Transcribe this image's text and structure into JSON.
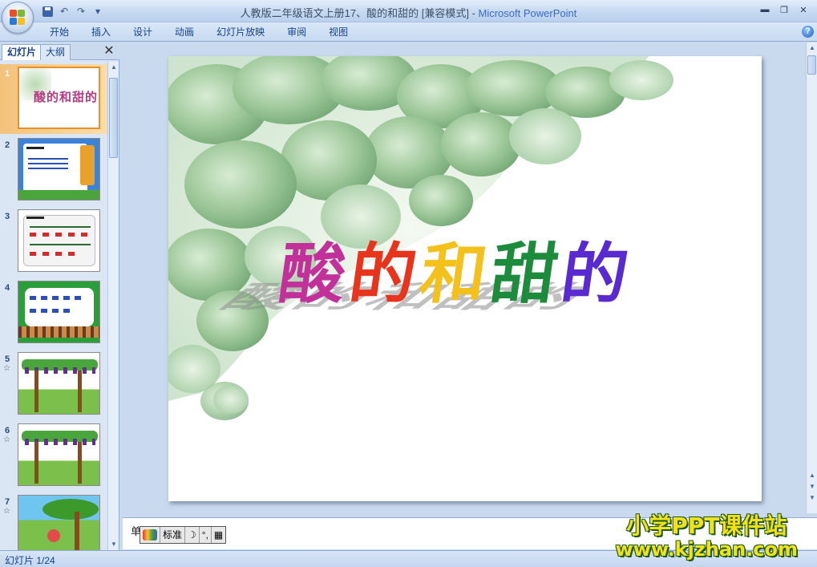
{
  "window": {
    "title_doc": "人教版二年级语文上册17、酸的和甜的 [兼容模式]",
    "title_sep": " - ",
    "title_app": "Microsoft PowerPoint"
  },
  "qat": {
    "save": "save-icon",
    "undo": "↶",
    "redo": "↷",
    "more": "▾"
  },
  "window_controls": {
    "minimize": "▬",
    "restore": "❐",
    "close": "✕"
  },
  "ribbon": {
    "tabs": [
      "开始",
      "插入",
      "设计",
      "动画",
      "幻灯片放映",
      "审阅",
      "视图"
    ],
    "help": "?"
  },
  "pane": {
    "tab_slides": "幻灯片",
    "tab_outline": "大纲",
    "close": "✕",
    "thumbnails": [
      {
        "num": "1",
        "star": "",
        "title": "酸的和甜的"
      },
      {
        "num": "2",
        "star": "",
        "title": ""
      },
      {
        "num": "3",
        "star": "",
        "title": ""
      },
      {
        "num": "4",
        "star": "",
        "title": ""
      },
      {
        "num": "5",
        "star": "☆",
        "title": ""
      },
      {
        "num": "6",
        "star": "☆",
        "title": ""
      },
      {
        "num": "7",
        "star": "☆",
        "title": ""
      }
    ]
  },
  "slide": {
    "title_chars": [
      "酸",
      "的",
      "和",
      "甜",
      "的"
    ],
    "title_colors": [
      "#c2309a",
      "#e8341c",
      "#f3c01c",
      "#1c8c3c",
      "#5a2ad1"
    ]
  },
  "notes": {
    "text": "单"
  },
  "ime": {
    "mode": "标准",
    "moon": "☽",
    "punct": "°,",
    "kbd": "▦"
  },
  "status": {
    "slide_count": "幻灯片 1/24"
  },
  "watermark": {
    "line1": "小学PPT课件站",
    "line2": "www.kjzhan.com"
  },
  "colors": {
    "ribbon_text": "#15428b",
    "selection": "#f3c27b"
  }
}
